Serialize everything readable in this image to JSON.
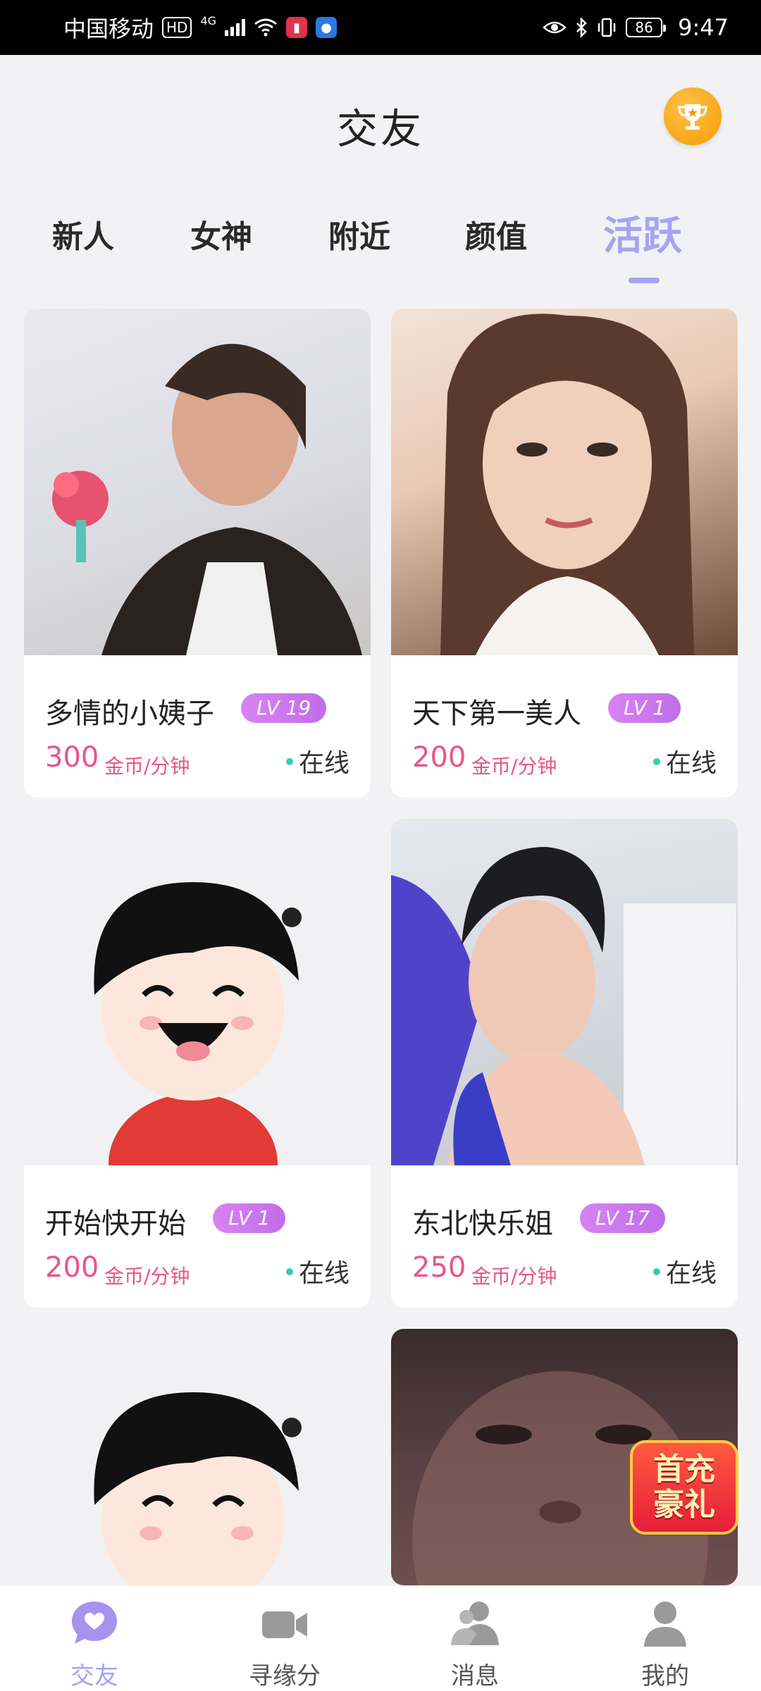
{
  "status_bar": {
    "carrier": "中国移动",
    "hd": "HD",
    "network": "4G",
    "battery": "86",
    "time": "9:47"
  },
  "header": {
    "title": "交友",
    "trophy_icon": "trophy-icon"
  },
  "tabs": [
    {
      "label": "新人"
    },
    {
      "label": "女神"
    },
    {
      "label": "附近"
    },
    {
      "label": "颜值"
    },
    {
      "label": "活跃",
      "active": true
    }
  ],
  "cards": [
    {
      "name": "多情的小姨子",
      "level": "LV 19",
      "price": "300",
      "unit": "金币/分钟",
      "status": "在线"
    },
    {
      "name": "天下第一美人",
      "level": "LV 1",
      "price": "200",
      "unit": "金币/分钟",
      "status": "在线"
    },
    {
      "name": "开始快开始",
      "level": "LV 1",
      "price": "200",
      "unit": "金币/分钟",
      "status": "在线"
    },
    {
      "name": "东北快乐姐",
      "level": "LV 17",
      "price": "250",
      "unit": "金币/分钟",
      "status": "在线"
    }
  ],
  "promo": {
    "line1": "首充",
    "line2": "豪礼"
  },
  "bottom_nav": [
    {
      "label": "交友",
      "icon": "heart-chat-icon",
      "active": true
    },
    {
      "label": "寻缘分",
      "icon": "video-camera-icon"
    },
    {
      "label": "消息",
      "icon": "users-icon"
    },
    {
      "label": "我的",
      "icon": "person-icon"
    }
  ],
  "colors": {
    "accent": "#a7a3f2",
    "price": "#e8558a",
    "level_badge": "#d080f0",
    "online_dot": "#39c9b0"
  }
}
